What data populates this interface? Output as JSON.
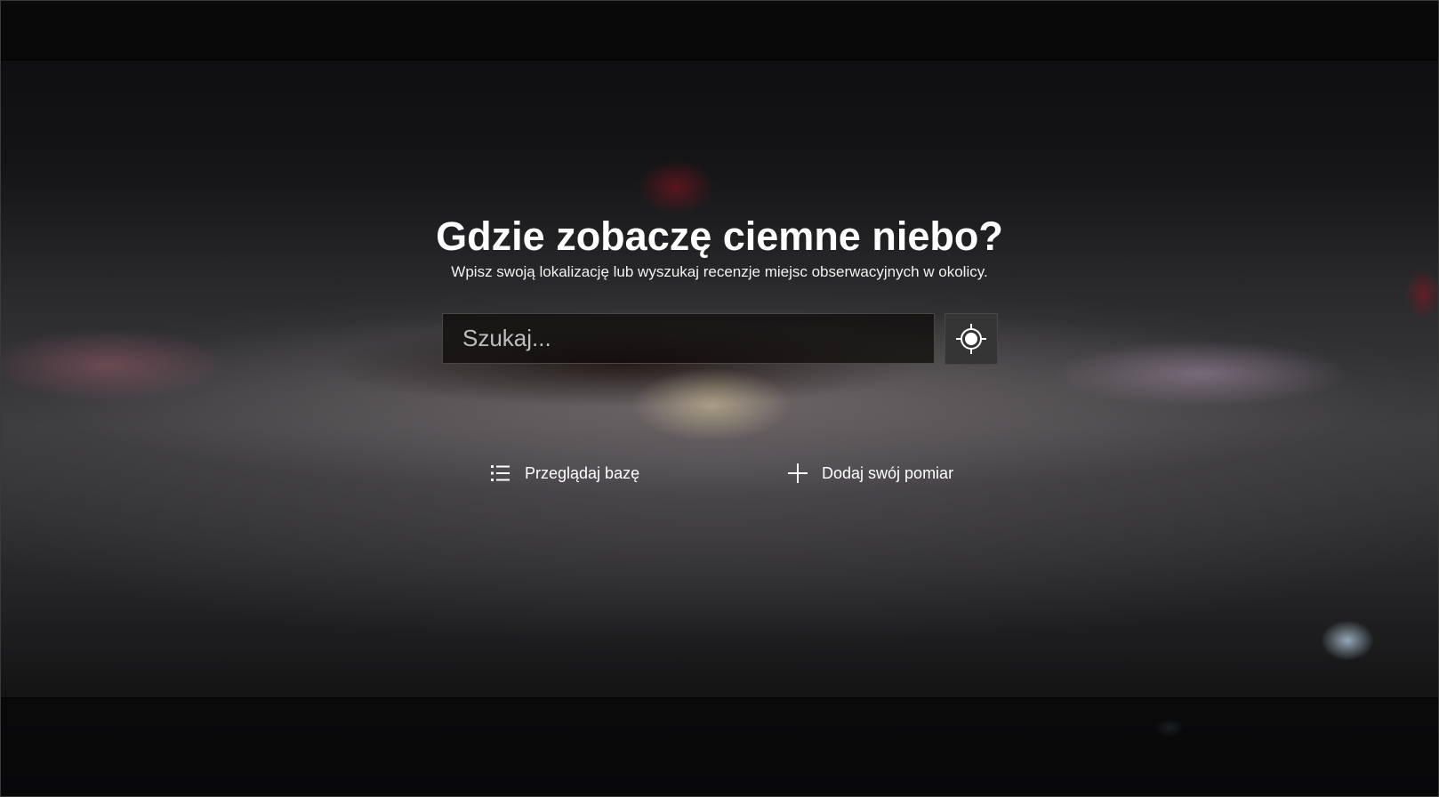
{
  "hero": {
    "title": "Gdzie zobaczę ciemne niebo?",
    "subtitle": "Wpisz swoją lokalizację lub wyszukaj recenzje miejsc obserwacyjnych w okolicy."
  },
  "search": {
    "placeholder": "Szukaj...",
    "value": ""
  },
  "locate_button": {
    "icon": "crosshair-icon"
  },
  "actions": {
    "browse": {
      "label": "Przeglądaj bazę",
      "icon": "list-icon"
    },
    "add": {
      "label": "Dodaj swój pomiar",
      "icon": "plus-icon"
    }
  },
  "colors": {
    "text": "#ffffff",
    "search_bg": "#0c0a09",
    "button_bg": "#353535"
  }
}
